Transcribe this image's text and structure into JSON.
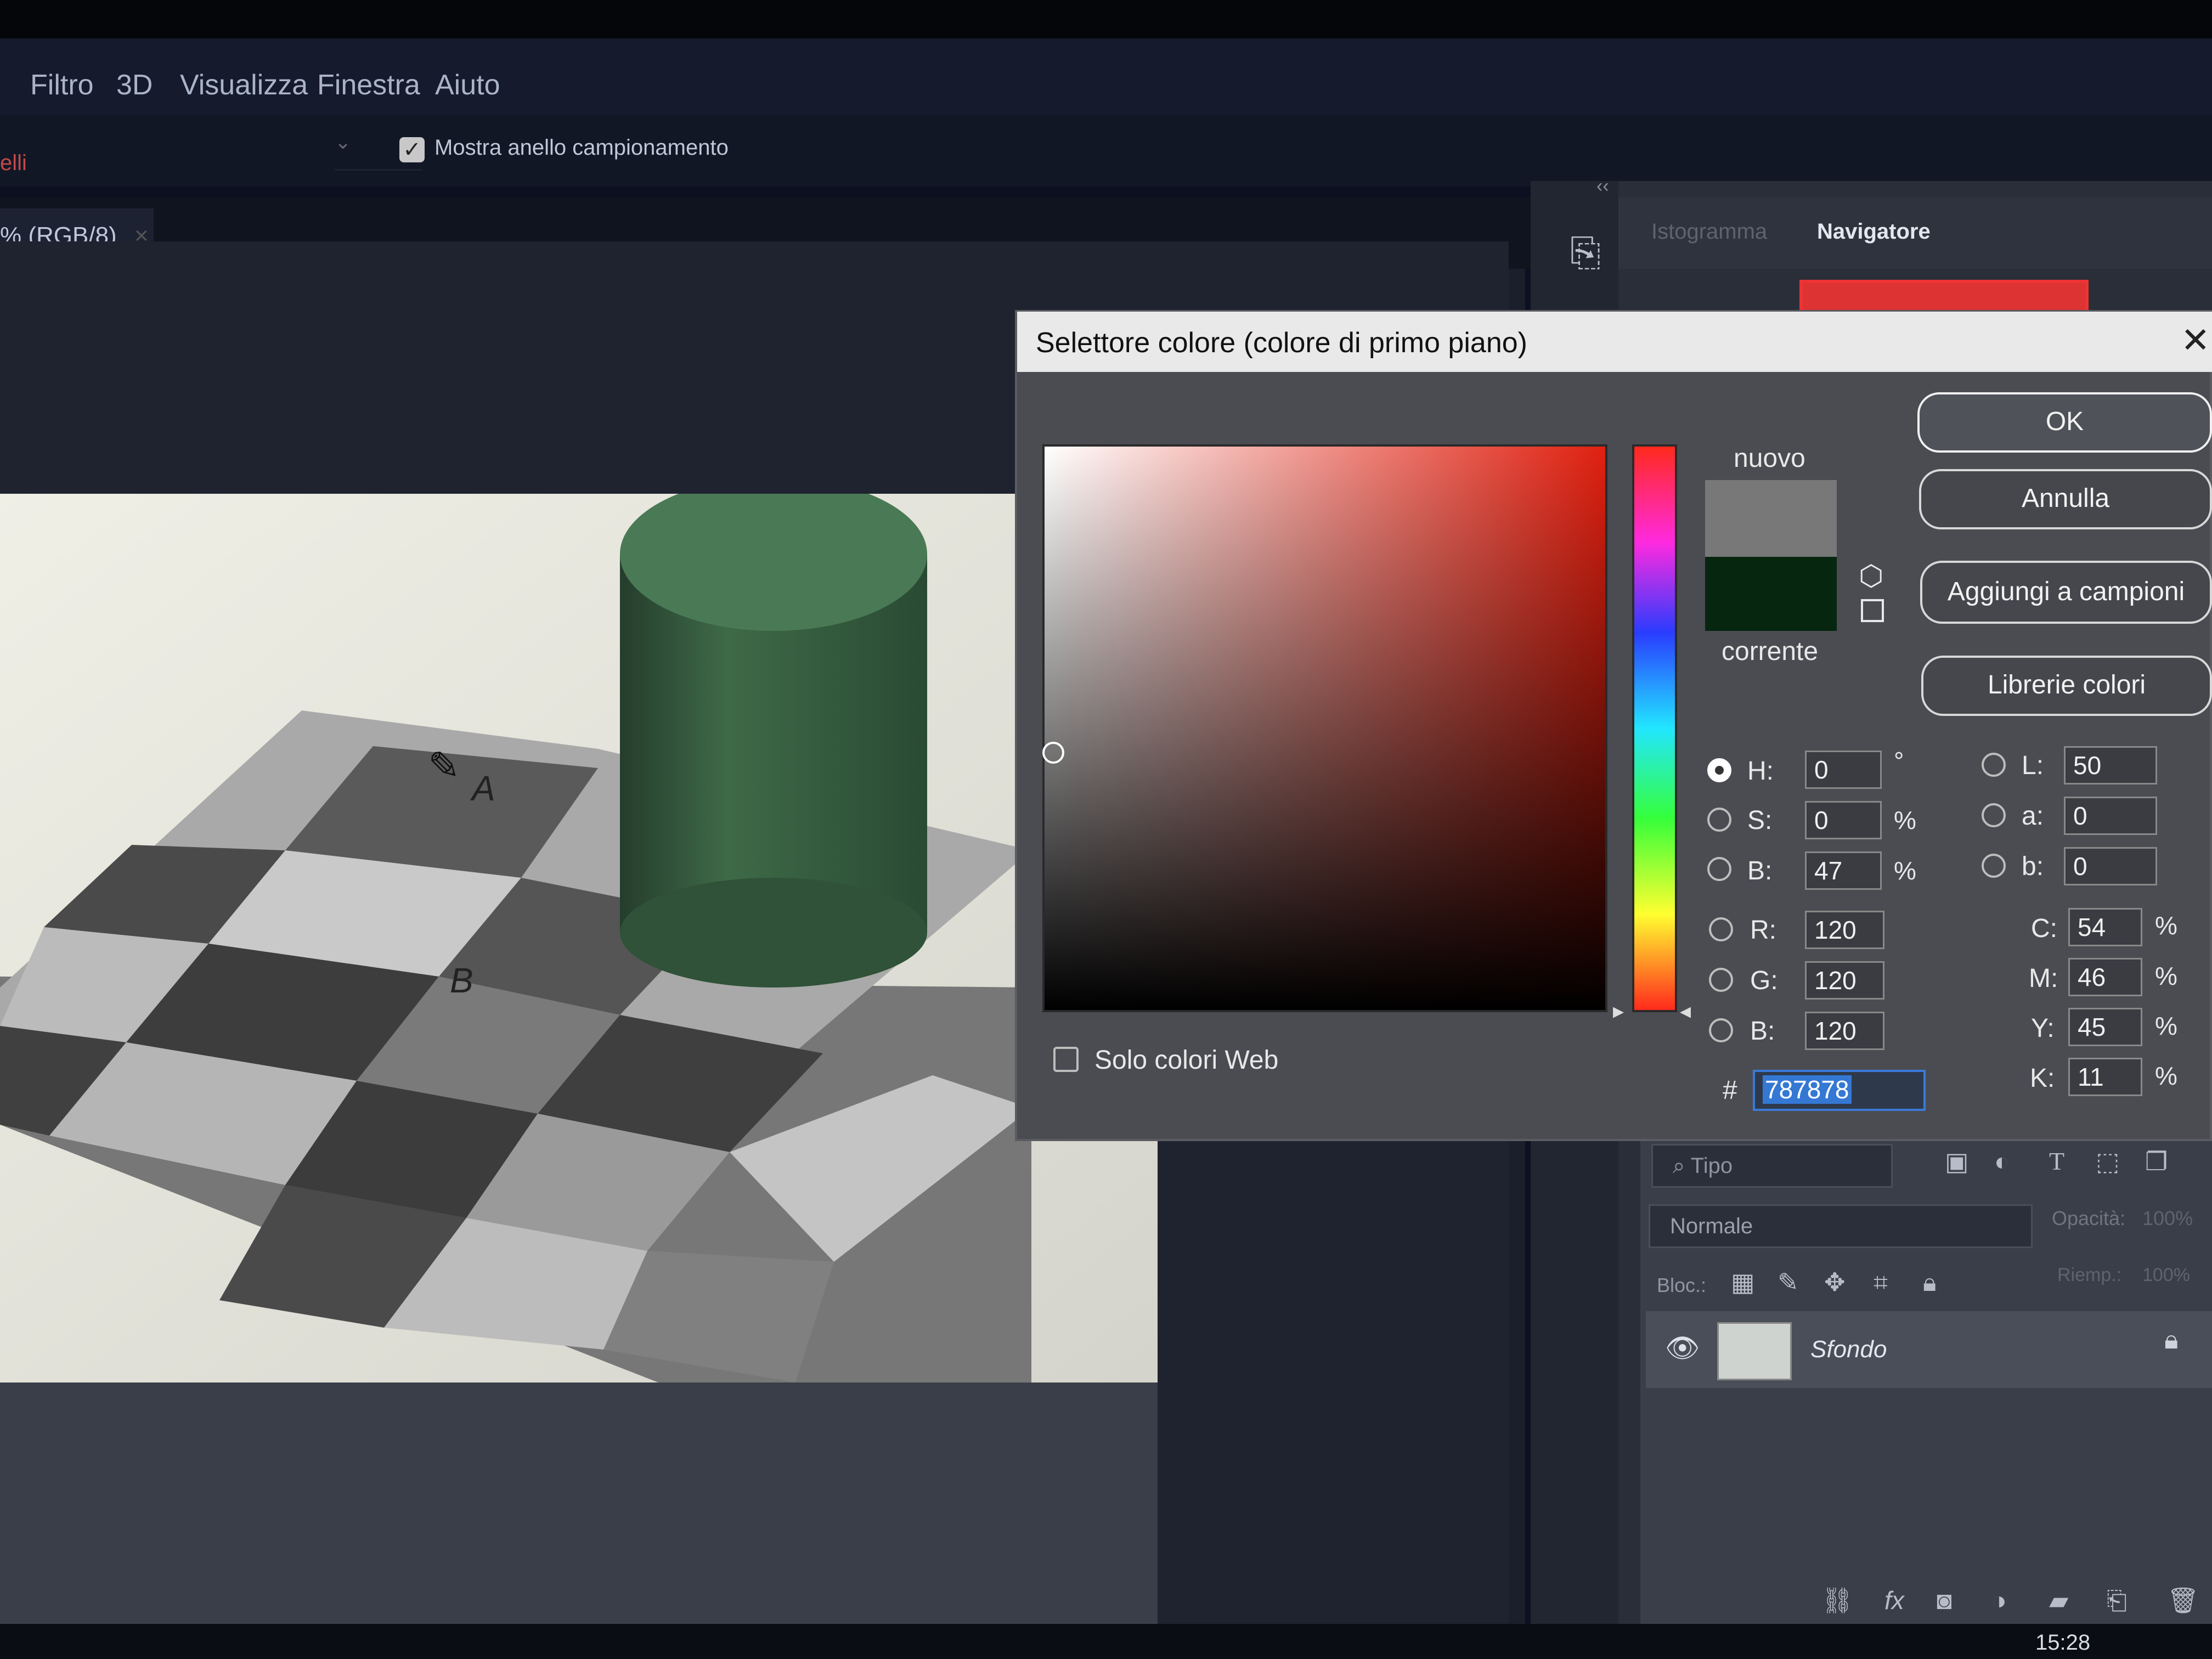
{
  "menubar": {
    "items": [
      "Filtro",
      "3D",
      "Visualizza",
      "Finestra",
      "Aiuto"
    ]
  },
  "options_bar": {
    "sample_label_fragment": "elli",
    "sample_ring_checkbox": "Mostra anello campionamento",
    "sample_ring_checked": true
  },
  "document": {
    "tab_label": "% (RGB/8)",
    "tab_close": "×",
    "image_labels": {
      "a": "A",
      "b": "B"
    }
  },
  "right_dock": {
    "collapse": "‹‹",
    "tabs": [
      "Istogramma",
      "Navigatore"
    ],
    "active_tab": "Navigatore"
  },
  "layers_panel": {
    "filter_placeholder": "Tipo",
    "blend_mode": "Normale",
    "opacity_label": "Opacità:",
    "opacity_value": "100%",
    "lock_label": "Bloc.:",
    "fill_label": "Riemp.:",
    "fill_value": "100%",
    "layer_name": "Sfondo"
  },
  "dialog": {
    "title": "Selettore colore (colore di primo piano)",
    "close": "✕",
    "new_label": "nuovo",
    "current_label": "corrente",
    "new_color": "#787878",
    "current_color": "#07260f",
    "buttons": {
      "ok": "OK",
      "cancel": "Annulla",
      "add_swatch": "Aggiungi a campioni",
      "libraries": "Librerie colori"
    },
    "web_only_label": "Solo colori Web",
    "hsb": {
      "h_label": "H:",
      "h_value": "0",
      "h_unit": "°",
      "s_label": "S:",
      "s_value": "0",
      "s_unit": "%",
      "b_label": "B:",
      "b_value": "47",
      "b_unit": "%"
    },
    "rgb": {
      "r_label": "R:",
      "r_value": "120",
      "g_label": "G:",
      "g_value": "120",
      "b_label": "B:",
      "b_value": "120"
    },
    "lab": {
      "l_label": "L:",
      "l_value": "50",
      "a_label": "a:",
      "a_value": "0",
      "b_label": "b:",
      "b_value": "0"
    },
    "cmyk": {
      "c_label": "C:",
      "c_value": "54",
      "m_label": "M:",
      "m_value": "46",
      "y_label": "Y:",
      "y_value": "45",
      "k_label": "K:",
      "k_value": "11",
      "unit": "%"
    },
    "hex_label": "#",
    "hex_value": "787878"
  },
  "taskbar": {
    "clock": "15:28"
  }
}
